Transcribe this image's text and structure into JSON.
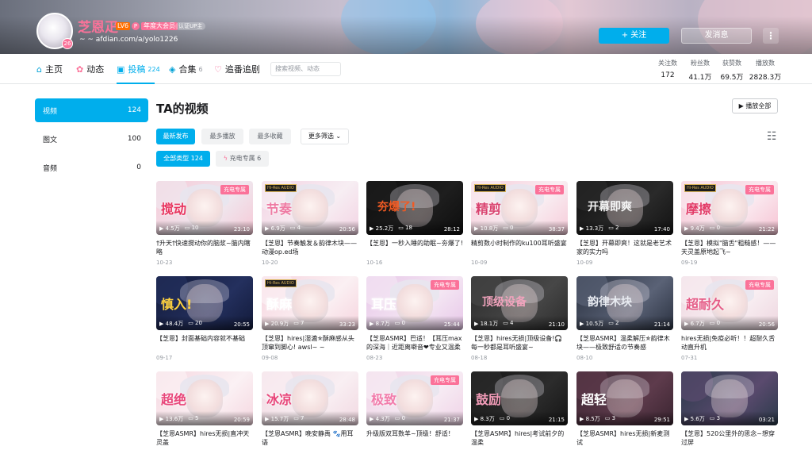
{
  "header": {
    "username": "芝恩疋",
    "level": "LV6",
    "vip_label": "年度大会员",
    "cert_label": "认证UP主",
    "sign": "~ ~ afdian.com/a/yolo1226",
    "follow_label": "+ 关注",
    "message_label": "发消息",
    "more_label": "⋮"
  },
  "nav": {
    "items": [
      {
        "label": "主页",
        "icon": "home-icon",
        "count": ""
      },
      {
        "label": "动态",
        "icon": "dynamic-icon",
        "count": ""
      },
      {
        "label": "投稿",
        "icon": "upload-icon",
        "count": "224"
      },
      {
        "label": "合集",
        "icon": "collection-icon",
        "count": "6"
      },
      {
        "label": "追番追剧",
        "icon": "heart-icon",
        "count": ""
      }
    ],
    "search_placeholder": "搜索视频、动态",
    "stats": [
      {
        "label": "关注数",
        "value": "172"
      },
      {
        "label": "粉丝数",
        "value": "41.1万"
      },
      {
        "label": "获赞数",
        "value": "69.5万"
      },
      {
        "label": "播放数",
        "value": "2828.3万"
      }
    ]
  },
  "sidebar": {
    "items": [
      {
        "label": "视频",
        "count": "124"
      },
      {
        "label": "图文",
        "count": "100"
      },
      {
        "label": "音频",
        "count": "0"
      }
    ]
  },
  "content": {
    "title": "TA的视频",
    "play_all": "▶ 播放全部",
    "sort_tabs": [
      "最新发布",
      "最多播放",
      "最多收藏"
    ],
    "filter_more": "更多筛选",
    "type_tabs": [
      "全部类型 124",
      "充电专属 6"
    ],
    "charge_badge": "充电专属",
    "hires_label": "Hi-Res AUDIO"
  },
  "videos": [
    {
      "title": "†升天†快速搅动你的脑浆~脑内瞎略",
      "date": "10-23",
      "plays": "4.5万",
      "danmaku": "10",
      "duration": "23:10",
      "bg1": "#f6c8d6",
      "bg2": "#efe7ee",
      "charge": true,
      "hires": false,
      "text": "搅动",
      "textColor": "#e8345e"
    },
    {
      "title": "【芝恩】节奏触发＆韵律木块——动漫op.ed场",
      "date": "10-20",
      "plays": "6.9万",
      "danmaku": "4",
      "duration": "20:56",
      "bg1": "#f3d3e3",
      "bg2": "#f7eef3",
      "charge": false,
      "hires": true,
      "text": "节奏",
      "textColor": "#ee7aa3"
    },
    {
      "title": "【芝恩】一秒入睡的助眠~夯爆了!",
      "date": "10-16",
      "plays": "25.2万",
      "danmaku": "18",
      "duration": "28:12",
      "bg1": "#0d0d0d",
      "bg2": "#1e1e1e",
      "charge": false,
      "hires": false,
      "text": "夯爆了!",
      "textColor": "#f05a23"
    },
    {
      "title": "精剪数小时制作的ku100耳听盛宴",
      "date": "10-09",
      "plays": "10.8万",
      "danmaku": "0",
      "duration": "38:37",
      "bg1": "#f6cbd9",
      "bg2": "#f9eef2",
      "charge": true,
      "hires": true,
      "text": "精剪",
      "textColor": "#d9426f"
    },
    {
      "title": "【芝恩】开幕即爽！这就是老艺术家的实力吗",
      "date": "10-09",
      "plays": "13.3万",
      "danmaku": "2",
      "duration": "17:40",
      "bg1": "#121212",
      "bg2": "#2a2a2a",
      "charge": false,
      "hires": false,
      "text": "开幕即爽",
      "textColor": "#f5f5f5"
    },
    {
      "title": "【芝恩】模拟\"脑舌\"粗糙感！——天灵盖原地起飞~",
      "date": "09-19",
      "plays": "9.4万",
      "danmaku": "0",
      "duration": "21:22",
      "bg1": "#f7c3d3",
      "bg2": "#faeaf0",
      "charge": true,
      "hires": true,
      "text": "摩擦",
      "textColor": "#e23a67"
    },
    {
      "title": "【芝恩】封面基础内容就不基础",
      "date": "09-17",
      "plays": "48.4万",
      "danmaku": "20",
      "duration": "20:55",
      "bg1": "#121a3a",
      "bg2": "#24305e",
      "charge": false,
      "hires": false,
      "text": "慎入!",
      "textColor": "#ffd23f"
    },
    {
      "title": "【芝恩】hires|湿漉✯酥麻感从头顶窜到脚心! awsl~ ~",
      "date": "09-08",
      "plays": "20.9万",
      "danmaku": "7",
      "duration": "33:23",
      "bg1": "#f6d4de",
      "bg2": "#fbf0f3",
      "charge": false,
      "hires": true,
      "text": "酥麻",
      "textColor": "#ffffff"
    },
    {
      "title": "【芝恩ASMR】巴适！【耳压max的深海｜近距离噼音❤专业又温柔",
      "date": "08-23",
      "plays": "8.7万",
      "danmaku": "0",
      "duration": "25:44",
      "bg1": "#e7c7e8",
      "bg2": "#f4e6f3",
      "charge": true,
      "hires": false,
      "text": "耳压",
      "textColor": "#ffffff"
    },
    {
      "title": "【芝恩】hires无损|顶级设备!🎧每一秒都是耳听盛宴~",
      "date": "08-18",
      "plays": "18.1万",
      "danmaku": "4",
      "duration": "21:10",
      "bg1": "#2b2b2b",
      "bg2": "#474747",
      "charge": false,
      "hires": false,
      "text": "顶级设备",
      "textColor": "#f2a3bd"
    },
    {
      "title": "【芝恩ASMR】温柔解压✯韵律木块——极致舒适の节奏感",
      "date": "08-10",
      "plays": "10.5万",
      "danmaku": "2",
      "duration": "21:14",
      "bg1": "#2a3140",
      "bg2": "#5a6276",
      "charge": false,
      "hires": false,
      "text": "韵律木块",
      "textColor": "#e9ecf2"
    },
    {
      "title": "hires无损|免疫必听！！超耐久舌动直升机",
      "date": "07-31",
      "plays": "6.7万",
      "danmaku": "0",
      "duration": "20:56",
      "bg1": "#eed6df",
      "bg2": "#f8eef2",
      "charge": true,
      "hires": false,
      "text": "超耐久",
      "textColor": "#e55b86"
    },
    {
      "title": "【芝恩ASMR】hires无损|直冲天灵盖",
      "date": "",
      "plays": "13.6万",
      "danmaku": "5",
      "duration": "20:59",
      "bg1": "#f5d7e0",
      "bg2": "#fbf1f4",
      "charge": false,
      "hires": false,
      "text": "超绝",
      "textColor": "#e8467a"
    },
    {
      "title": "【芝恩ASMR】晚安静禹 🐾用耳语",
      "date": "",
      "plays": "15.7万",
      "danmaku": "7",
      "duration": "28:48",
      "bg1": "#f1d8e1",
      "bg2": "#f9eff3",
      "charge": false,
      "hires": false,
      "text": "冰凉",
      "textColor": "#e8467a"
    },
    {
      "title": "升级版双耳数羊~顶级！舒适！",
      "date": "",
      "plays": "4.3万",
      "danmaku": "0",
      "duration": "21:37",
      "bg1": "#efd2e6",
      "bg2": "#f7ecf4",
      "charge": true,
      "hires": false,
      "text": "极致",
      "textColor": "#f27cab"
    },
    {
      "title": "【芝恩ASMR】hires|考试前夕的温柔",
      "date": "",
      "plays": "8.3万",
      "danmaku": "0",
      "duration": "21:15",
      "bg1": "#151515",
      "bg2": "#2c2c2c",
      "charge": false,
      "hires": false,
      "text": "鼓励",
      "textColor": "#f29cb8"
    },
    {
      "title": "【芝恩ASMR】hires无损|新麦测试",
      "date": "",
      "plays": "8.5万",
      "danmaku": "3",
      "duration": "29:51",
      "bg1": "#3a2430",
      "bg2": "#5e3b4c",
      "charge": false,
      "hires": false,
      "text": "超轻",
      "textColor": "#ffffff"
    },
    {
      "title": "【芝恩】520公里外的思念~想穿过屏",
      "date": "",
      "plays": "5.6万",
      "danmaku": "3",
      "duration": "03:21",
      "bg1": "#2a3a4a",
      "bg2": "#5a4a6e",
      "charge": false,
      "hires": false,
      "text": "",
      "textColor": "#ffffff"
    }
  ]
}
